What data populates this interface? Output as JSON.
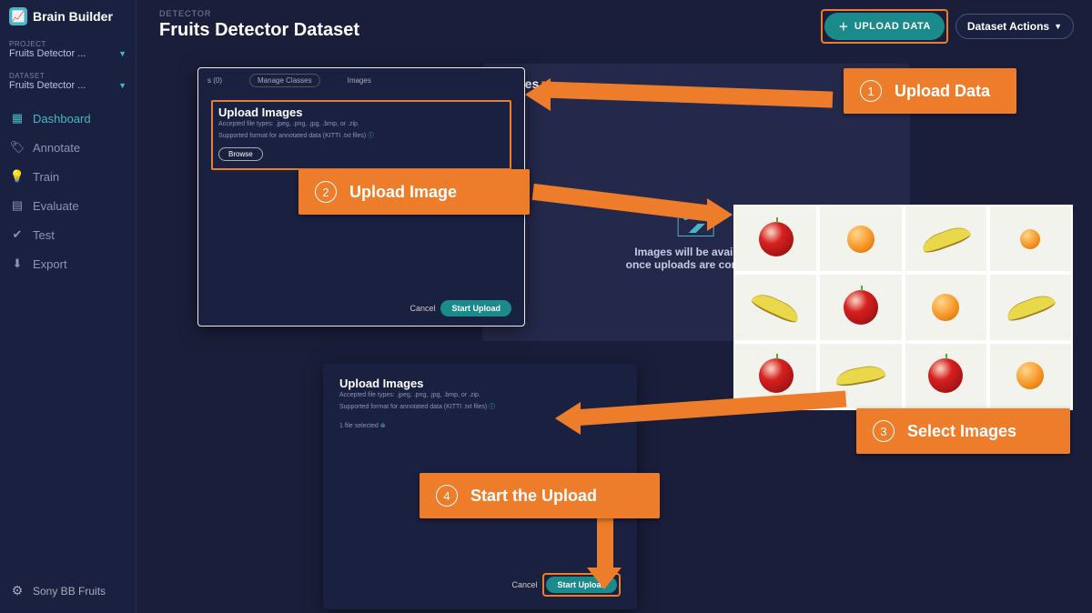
{
  "brand": "Brain Builder",
  "sidebar": {
    "project_label": "PROJECT",
    "project_value": "Fruits Detector ...",
    "dataset_label": "DATASET",
    "dataset_value": "Fruits Detector ...",
    "items": [
      {
        "icon": "grid",
        "label": "Dashboard",
        "active": true
      },
      {
        "icon": "tag",
        "label": "Annotate"
      },
      {
        "icon": "bulb",
        "label": "Train"
      },
      {
        "icon": "list",
        "label": "Evaluate"
      },
      {
        "icon": "check",
        "label": "Test"
      },
      {
        "icon": "download",
        "label": "Export"
      }
    ],
    "footer": "Sony BB Fruits"
  },
  "header": {
    "kicker": "DETECTOR",
    "title": "Fruits Detector Dataset",
    "upload_btn": "UPLOAD DATA",
    "actions_btn": "Dataset Actions"
  },
  "images_card": {
    "title": "Images",
    "placeholder_line1": "Images will be available",
    "placeholder_line2": "once uploads are complete"
  },
  "modal1": {
    "tab_left": "s (0)",
    "tab_mid": "Manage Classes",
    "tab_right": "Images",
    "title": "Upload Images",
    "accepted": "Accepted file types: .jpeg, .png, .jpg, .bmp, or .zip.",
    "supported": "Supported format for annotated data (KITTI .txt files)",
    "browse": "Browse",
    "cancel": "Cancel",
    "start": "Start Upload"
  },
  "modal2": {
    "title": "Upload Images",
    "accepted": "Accepted file types: .jpeg, .png, .jpg, .bmp, or .zip.",
    "supported": "Supported format for annotated data (KITTI .txt files)",
    "selected": "1 file selected",
    "cancel": "Cancel",
    "start": "Start Upload"
  },
  "callouts": {
    "c1": "Upload Data",
    "c2": "Upload Image",
    "c3": "Select Images",
    "c4": "Start the Upload"
  }
}
